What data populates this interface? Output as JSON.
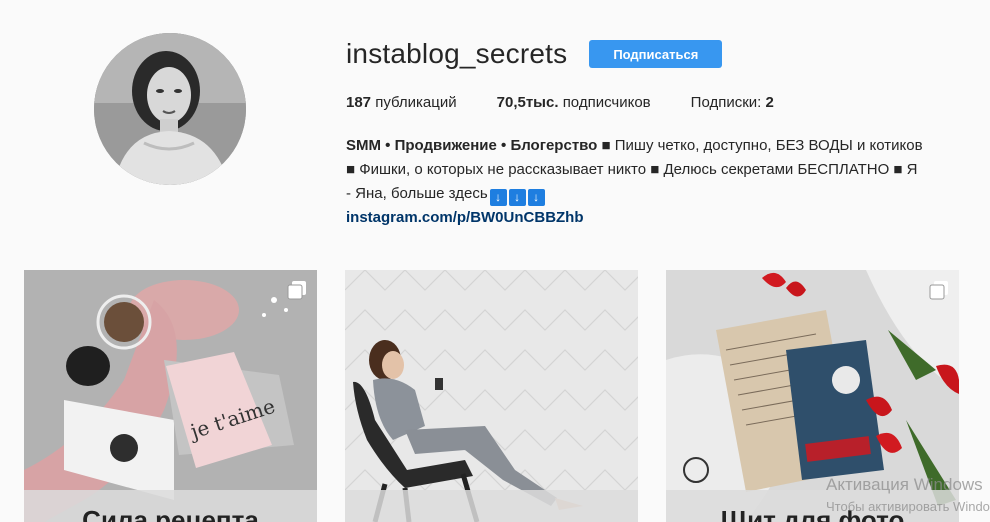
{
  "profile": {
    "username": "instablog_secrets",
    "follow_label": "Подписаться",
    "stats": {
      "posts_count": "187",
      "posts_label": "публикаций",
      "followers_count": "70,5тыс.",
      "followers_label": "подписчиков",
      "following_label": "Подписки:",
      "following_count": "2"
    },
    "bio": {
      "title": "SMM • Продвижение • Блогерство",
      "line1": " ■ Пишу четко, доступно, БЕЗ ВОДЫ и котиков",
      "line2": "■ Фишки, о которых не рассказывает никто ■ Делюсь секретами БЕСПЛАТНО ■ Я",
      "line3": "- Яна, больше здесь",
      "arrows": [
        "↓",
        "↓",
        "↓"
      ],
      "link": "instagram.com/p/BW0UnCBBZhb"
    },
    "avatar_icon": "profile-photo"
  },
  "posts": [
    {
      "caption": "Сила рецепта",
      "multi_icon": "multiple-images-icon"
    },
    {
      "caption": "",
      "multi_icon": ""
    },
    {
      "caption": "Щит для фото",
      "multi_icon": "multiple-images-icon"
    }
  ],
  "watermark": {
    "line1": "Активация Windows",
    "line2": "Чтобы активировать Windows"
  },
  "colors": {
    "accent": "#3897f0",
    "link": "#003569",
    "background": "#fafafa"
  }
}
